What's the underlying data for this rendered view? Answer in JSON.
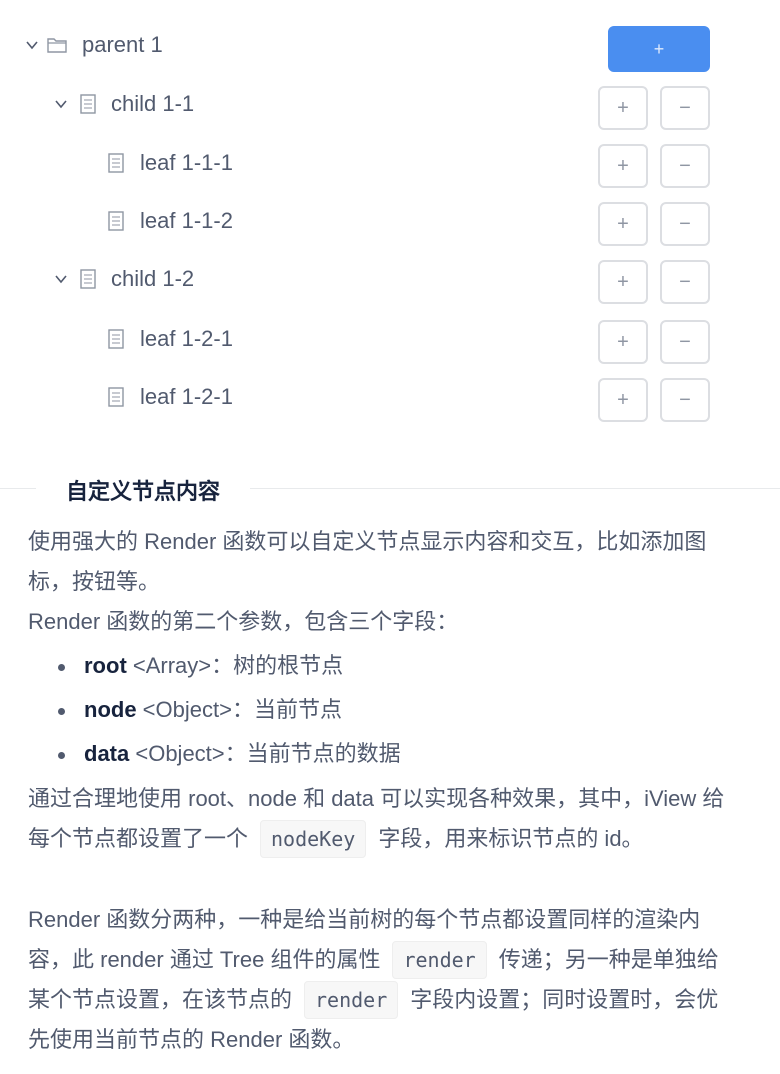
{
  "tree": {
    "nodes": [
      {
        "label": "parent 1",
        "icon": "folder-icon",
        "expanded": true
      },
      {
        "label": "child 1-1",
        "icon": "file-icon",
        "expanded": true
      },
      {
        "label": "leaf 1-1-1",
        "icon": "file-icon"
      },
      {
        "label": "leaf 1-1-2",
        "icon": "file-icon"
      },
      {
        "label": "child 1-2",
        "icon": "file-icon",
        "expanded": true
      },
      {
        "label": "leaf 1-2-1",
        "icon": "file-icon"
      },
      {
        "label": "leaf 1-2-1",
        "icon": "file-icon"
      }
    ],
    "add_label": "+",
    "remove_label": "−",
    "accent_color": "#4a8ef0"
  },
  "doc": {
    "section_title": "自定义节点内容",
    "intro": "使用强大的 Render 函数可以自定义节点显示内容和交互，比如添加图标，按钮等。",
    "params_intro": "Render 函数的第二个参数，包含三个字段：",
    "params": [
      {
        "name": "root",
        "type": " <Array>：树的根节点"
      },
      {
        "name": "node",
        "type": " <Object>：当前节点"
      },
      {
        "name": "data",
        "type": " <Object>：当前节点的数据"
      }
    ],
    "p3_a": "通过合理地使用 root、node 和 data 可以实现各种效果，其中，iView 给每个节点都设置了一个",
    "p3_code": "nodeKey",
    "p3_b": "字段，用来标识节点的 id。",
    "p4_a": "Render 函数分两种，一种是给当前树的每个节点都设置同样的渲染内容，此 render 通过 Tree 组件的属性",
    "p4_code1": "render",
    "p4_b": "传递；另一种是单独给某个节点设置，在该节点的",
    "p4_code2": "render",
    "p4_c": "字段内设置；同时设置时，会优先使用当前节点的 Render 函数。"
  }
}
